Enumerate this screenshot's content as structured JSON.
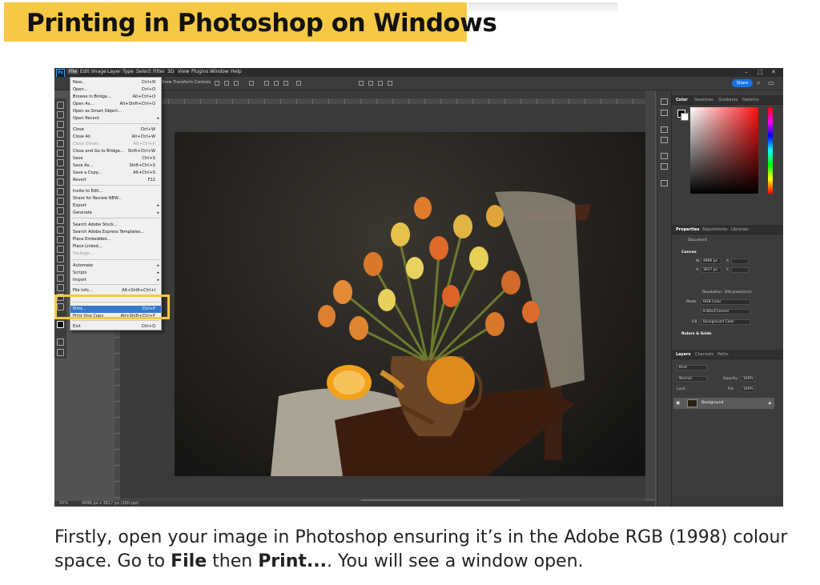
{
  "title": "Printing in Photoshop on Windows",
  "caption": {
    "part1": "Firstly, open your image in Photoshop ensuring it’s in the Adobe RGB (1998) colour space. Go to ",
    "file": "File",
    "part2": " then ",
    "print": "Print...",
    "part3": ". You will see a window open."
  },
  "app": {
    "logo": "Ps",
    "menus": [
      "File",
      "Edit",
      "Image",
      "Layer",
      "Type",
      "Select",
      "Filter",
      "3D",
      "View",
      "Plugins",
      "Window",
      "Help"
    ],
    "options_label": "Show Transform Controls",
    "share": "Share",
    "zoom": "25%",
    "doc_info": "4996 px x 3617 px (300 ppi)"
  },
  "file_menu": {
    "items": [
      {
        "label": "New...",
        "shortcut": "Ctrl+N"
      },
      {
        "label": "Open...",
        "shortcut": "Ctrl+O"
      },
      {
        "label": "Browse in Bridge...",
        "shortcut": "Alt+Ctrl+O"
      },
      {
        "label": "Open As...",
        "shortcut": "Alt+Shift+Ctrl+O"
      },
      {
        "label": "Open as Smart Object...",
        "shortcut": ""
      },
      {
        "label": "Open Recent",
        "shortcut": ""
      },
      {
        "label": "Close",
        "shortcut": "Ctrl+W"
      },
      {
        "label": "Close All",
        "shortcut": "Alt+Ctrl+W"
      },
      {
        "label": "Close Others",
        "shortcut": "Alt+Ctrl+P"
      },
      {
        "label": "Close and Go to Bridge...",
        "shortcut": "Shift+Ctrl+W"
      },
      {
        "label": "Save",
        "shortcut": "Ctrl+S"
      },
      {
        "label": "Save As...",
        "shortcut": "Shift+Ctrl+S"
      },
      {
        "label": "Save a Copy...",
        "shortcut": "Alt+Ctrl+S"
      },
      {
        "label": "Revert",
        "shortcut": "F12"
      },
      {
        "label": "Invite to Edit...",
        "shortcut": ""
      },
      {
        "label": "Share for Review NEW...",
        "shortcut": ""
      },
      {
        "label": "Export",
        "shortcut": ""
      },
      {
        "label": "Generate",
        "shortcut": ""
      },
      {
        "label": "Search Adobe Stock...",
        "shortcut": ""
      },
      {
        "label": "Search Adobe Express Templates...",
        "shortcut": ""
      },
      {
        "label": "Place Embedded...",
        "shortcut": ""
      },
      {
        "label": "Place Linked...",
        "shortcut": ""
      },
      {
        "label": "Package...",
        "shortcut": ""
      },
      {
        "label": "Automate",
        "shortcut": ""
      },
      {
        "label": "Scripts",
        "shortcut": ""
      },
      {
        "label": "Import",
        "shortcut": ""
      },
      {
        "label": "File Info...",
        "shortcut": "Alt+Shift+Ctrl+I"
      },
      {
        "label": "Print...",
        "shortcut": "Ctrl+P"
      },
      {
        "label": "Print One Copy",
        "shortcut": "Alt+Shift+Ctrl+P"
      },
      {
        "label": "Exit",
        "shortcut": "Ctrl+Q"
      }
    ]
  },
  "panels": {
    "color_tabs": [
      "Color",
      "Swatches",
      "Gradients",
      "Patterns"
    ],
    "prop_tabs": [
      "Properties",
      "Adjustments",
      "Libraries"
    ],
    "document": "Document",
    "canvas": "Canvas",
    "w_label": "W",
    "w_value": "4996 px",
    "h_label": "H",
    "h_value": "3617 px",
    "x_label": "X",
    "y_label": "Y",
    "resolution": "Resolution: 300 pixels/inch",
    "mode_label": "Mode",
    "mode_value": "RGB Color",
    "depth_value": "8 Bits/Channel",
    "fill_label": "Fill",
    "fill_value": "Background Color",
    "rulers": "Rulers & Grids",
    "layer_tabs": [
      "Layers",
      "Channels",
      "Paths"
    ],
    "kind": "Kind",
    "blend": "Normal",
    "opacity": "Opacity:",
    "opacity_value": "100%",
    "lock": "Lock:",
    "fill2": "Fill:",
    "fill2_value": "100%",
    "layer_name": "Background"
  }
}
